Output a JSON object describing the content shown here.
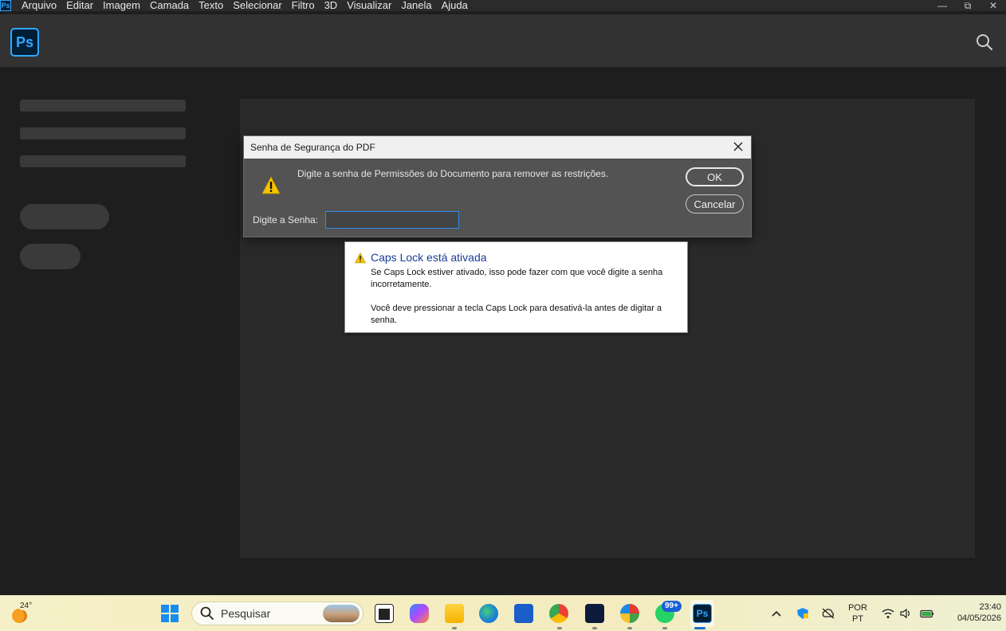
{
  "app": {
    "icon_label": "Ps"
  },
  "menu": [
    "Arquivo",
    "Editar",
    "Imagem",
    "Camada",
    "Texto",
    "Selecionar",
    "Filtro",
    "3D",
    "Visualizar",
    "Janela",
    "Ajuda"
  ],
  "window_controls": {
    "minimize": "—",
    "restore": "⧉",
    "close": "✕"
  },
  "dialog": {
    "title": "Senha de Segurança do PDF",
    "message": "Digite a senha de Permissões do Documento para remover as restrições.",
    "ok_label": "OK",
    "cancel_label": "Cancelar",
    "password_label": "Digite a Senha:",
    "password_value": ""
  },
  "balloon": {
    "title": "Caps Lock está ativada",
    "p1": "Se Caps Lock estiver ativado, isso pode fazer com que você digite a senha incorretamente.",
    "p2": "Você deve pressionar a tecla Caps Lock para desativá-la antes de digitar a senha."
  },
  "taskbar": {
    "temperature": "24°",
    "search_placeholder": "Pesquisar",
    "whatsapp_badge": "99+",
    "language_line1": "POR",
    "language_line2": "PT",
    "time": "23:40",
    "date": "04/05/2026"
  },
  "colors": {
    "ps_blue": "#31a8ff",
    "ps_navy": "#001e36",
    "focus_blue": "#2d8ceb",
    "warning_yellow": "#f5c400"
  }
}
